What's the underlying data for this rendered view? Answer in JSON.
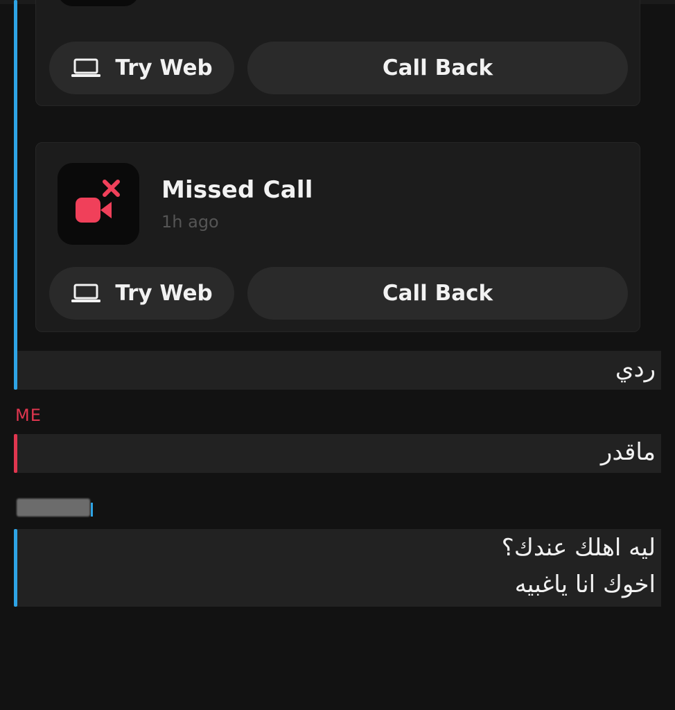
{
  "cards": [
    {
      "title": "",
      "time": "",
      "try_web_label": "Try Web",
      "call_back_label": "Call Back"
    },
    {
      "title": "Missed Call",
      "time": "1h ago",
      "try_web_label": "Try Web",
      "call_back_label": "Call Back"
    }
  ],
  "messages": [
    {
      "sender": "",
      "lines": [
        "ردي"
      ]
    },
    {
      "sender": "ME",
      "lines": [
        "ماقدر"
      ]
    },
    {
      "sender": "",
      "lines": [
        "ليه اهلك عندك؟",
        "اخوك انا ياغبيه"
      ]
    }
  ],
  "icons": {
    "laptop": "laptop-icon",
    "missed_video_call": "missed-video-call-icon"
  },
  "colors": {
    "background": "#121212",
    "card": "#1c1c1c",
    "button": "#2a2a2a",
    "friend_accent": "#2ea4e6",
    "me_accent": "#e0364f",
    "missed_call_icon": "#f0405a"
  }
}
